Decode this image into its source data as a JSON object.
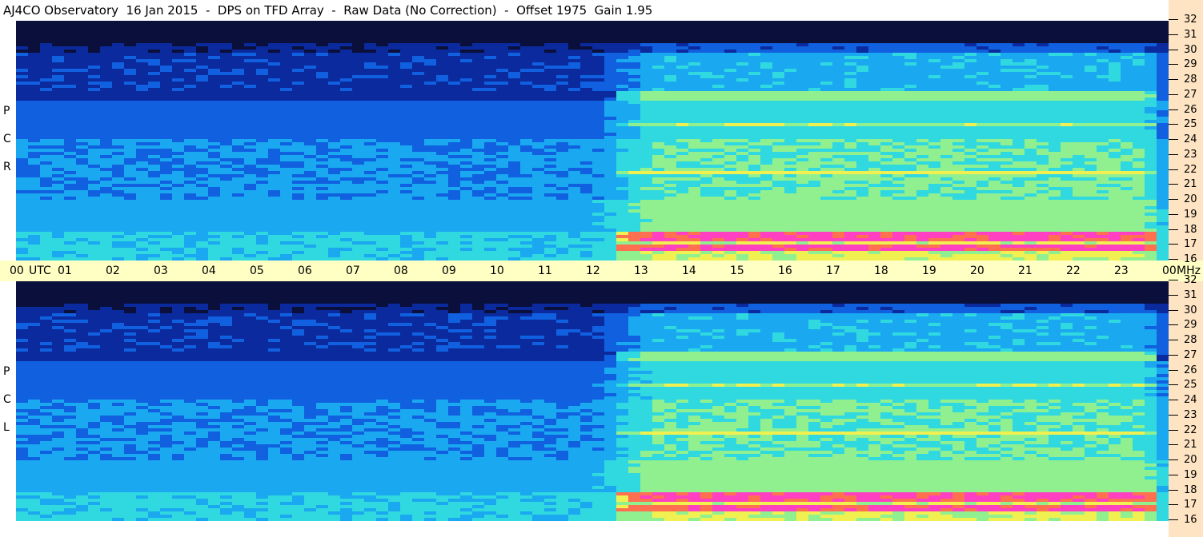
{
  "header": {
    "title": "AJ4CO Observatory  16 Jan 2015  -  DPS on TFD Array  -  Raw Data (No Correction)  -  Offset 1975  Gain 1.95"
  },
  "panels": [
    {
      "id": "rcp",
      "letters": [
        "P",
        "C",
        "R"
      ]
    },
    {
      "id": "lcp",
      "letters": [
        "P",
        "C",
        "L"
      ]
    }
  ],
  "chart_data": {
    "type": "heatmap",
    "title": "AJ4CO Observatory  16 Jan 2015  -  DPS on TFD Array  -  Raw Data (No Correction)  -  Offset 1975  Gain 1.95",
    "x_axis": {
      "unit_label": "UTC",
      "ticks": [
        "00",
        "01",
        "02",
        "03",
        "04",
        "05",
        "06",
        "07",
        "08",
        "09",
        "10",
        "11",
        "12",
        "13",
        "14",
        "15",
        "16",
        "17",
        "18",
        "19",
        "20",
        "21",
        "22",
        "23",
        "00"
      ],
      "range_hours": [
        0,
        24
      ]
    },
    "y_axis": {
      "unit_label": "MHz",
      "ticks": [
        "16",
        "17",
        "18",
        "19",
        "20",
        "21",
        "22",
        "23",
        "24",
        "25",
        "26",
        "27",
        "28",
        "29",
        "30",
        "31",
        "32"
      ],
      "range_mhz": [
        16,
        32
      ]
    },
    "colormap": [
      "#0a0f3c",
      "#0a2a9e",
      "#1060e0",
      "#1aa8f0",
      "#30d8e0",
      "#90f090",
      "#f0f050",
      "#ff7050",
      "#ff40c0"
    ],
    "polarizations": [
      "RCP",
      "LCP"
    ]
  },
  "colors": {
    "time_axis_bg": "#ffffc4",
    "freq_axis_bg": "#ffe4c4"
  }
}
